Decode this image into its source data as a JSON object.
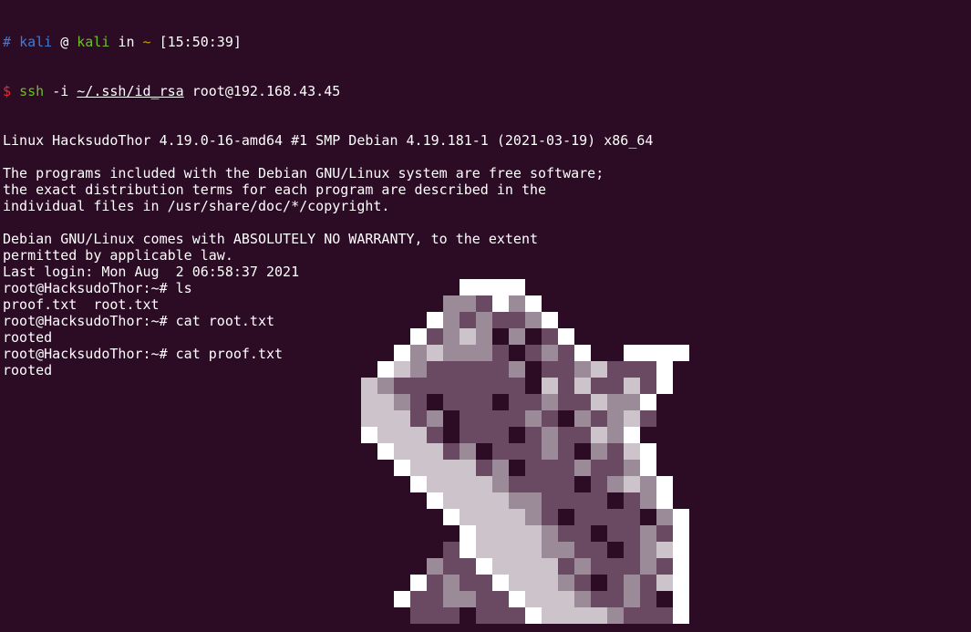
{
  "prompt": {
    "hash": "#",
    "user": "kali",
    "at": "@",
    "host": "kali",
    "in": "in",
    "dir": "~",
    "time": "[15:50:39]"
  },
  "command": {
    "dollar": "$",
    "prog": "ssh",
    "flag": "-i",
    "key_path": "~/.ssh/id_rsa",
    "target": "root@192.168.43.45"
  },
  "output_lines": [
    "Linux HacksudoThor 4.19.0-16-amd64 #1 SMP Debian 4.19.181-1 (2021-03-19) x86_64",
    "",
    "The programs included with the Debian GNU/Linux system are free software;",
    "the exact distribution terms for each program are described in the",
    "individual files in /usr/share/doc/*/copyright.",
    "",
    "Debian GNU/Linux comes with ABSOLUTELY NO WARRANTY, to the extent",
    "permitted by applicable law.",
    "Last login: Mon Aug  2 06:58:37 2021",
    "root@HacksudoThor:~# ls",
    "proof.txt  root.txt",
    "root@HacksudoThor:~# cat root.txt",
    "rooted",
    "root@HacksudoThor:~# cat proof.txt",
    "rooted"
  ],
  "colors": {
    "background": "#2c0b24",
    "text": "#ffffff",
    "prompt_blue": "#3f7bd6",
    "prompt_green": "#6fbf2a",
    "prompt_yellow": "#c4a000",
    "prompt_red": "#ef2929",
    "art_white": "#ffffff",
    "art_light": "#cdc3cb",
    "art_mid": "#9b8a97",
    "art_dark": "#6a4a62",
    "art_darkest": "#2c0b24"
  },
  "art_icon": "pixel-hammer-mjolnir-icon"
}
